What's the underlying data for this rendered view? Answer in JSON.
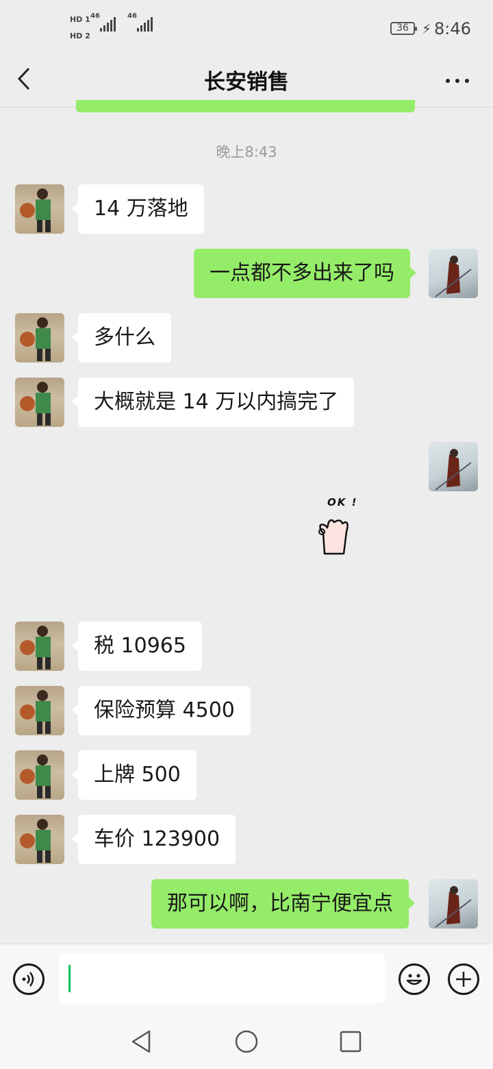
{
  "status_bar": {
    "hd1": "HD 1",
    "hd2": "HD 2",
    "signal1": "46",
    "signal2": "46",
    "battery": "36",
    "time": "8:46"
  },
  "header": {
    "title": "长安销售",
    "back_icon": "chevron-left-icon",
    "more_icon": "more-dots-icon"
  },
  "chat": {
    "timestamp": "晚上8:43",
    "messages": [
      {
        "side": "left",
        "text": "14 万落地"
      },
      {
        "side": "right",
        "text": "一点都不多出来了吗"
      },
      {
        "side": "left",
        "text": "多什么"
      },
      {
        "side": "left",
        "text": "大概就是 14 万以内搞完了"
      },
      {
        "side": "right",
        "type": "sticker",
        "sticker_text": "OK !"
      },
      {
        "side": "left",
        "text": "税 10965"
      },
      {
        "side": "left",
        "text": "保险预算 4500"
      },
      {
        "side": "left",
        "text": "上牌 500"
      },
      {
        "side": "left",
        "text": "车价 123900"
      },
      {
        "side": "right",
        "text": "那可以啊，比南宁便宜点"
      }
    ]
  },
  "input_bar": {
    "voice_icon": "voice-icon",
    "emoji_icon": "emoji-icon",
    "plus_icon": "plus-icon",
    "value": ""
  },
  "colors": {
    "background": "#ededed",
    "bubble_self": "#95ec69",
    "bubble_other": "#ffffff",
    "accent": "#07c160"
  }
}
